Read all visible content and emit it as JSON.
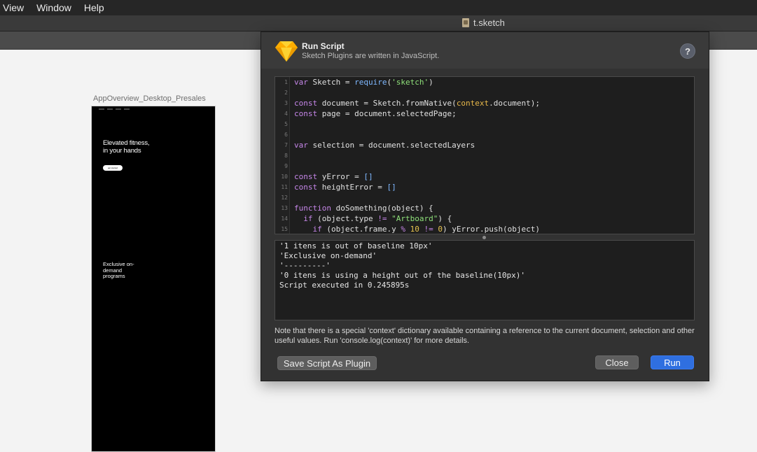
{
  "menubar": {
    "items": [
      "View",
      "Window",
      "Help"
    ]
  },
  "window": {
    "title": "t.sketch"
  },
  "artboard": {
    "label": "AppOverview_Desktop_Presales",
    "hero_text": "Elevated fitness, in your hands",
    "button_text": "get started",
    "feature_text": "Exclusive on-demand programs"
  },
  "dialog": {
    "title": "Run Script",
    "subtitle": "Sketch Plugins are written in JavaScript.",
    "help_label": "?",
    "line_numbers": [
      "1",
      "2",
      "3",
      "4",
      "5",
      "6",
      "7",
      "8",
      "9",
      "10",
      "11",
      "12",
      "13",
      "14",
      "15"
    ],
    "code_lines": [
      "var Sketch = require('sketch')",
      "",
      "const document = Sketch.fromNative(context.document);",
      "const page = document.selectedPage;",
      "",
      "",
      "var selection = document.selectedLayers",
      "",
      "",
      "const yError = []",
      "const heightError = []",
      "",
      "function doSomething(object) {",
      "  if (object.type != \"Artboard\") {",
      "    if (object.frame.y % 10 != 0) yError.push(object)"
    ],
    "output_lines": [
      "'1 itens is out of baseline 10px'",
      "'Exclusive on-demand'",
      "'---------'",
      "'0 itens is using a height out of the baseline(10px)'",
      "Script executed in 0.245895s"
    ],
    "note": "Note that there is a special 'context' dictionary available containing a reference to the current document, selection and other useful values. Run 'console.log(context)' for more details.",
    "save_button": "Save Script As Plugin",
    "close_button": "Close",
    "run_button": "Run"
  },
  "colors": {
    "run_button": "#2f6fe0",
    "dialog_bg": "#323232",
    "editor_bg": "#1e1e1e"
  }
}
